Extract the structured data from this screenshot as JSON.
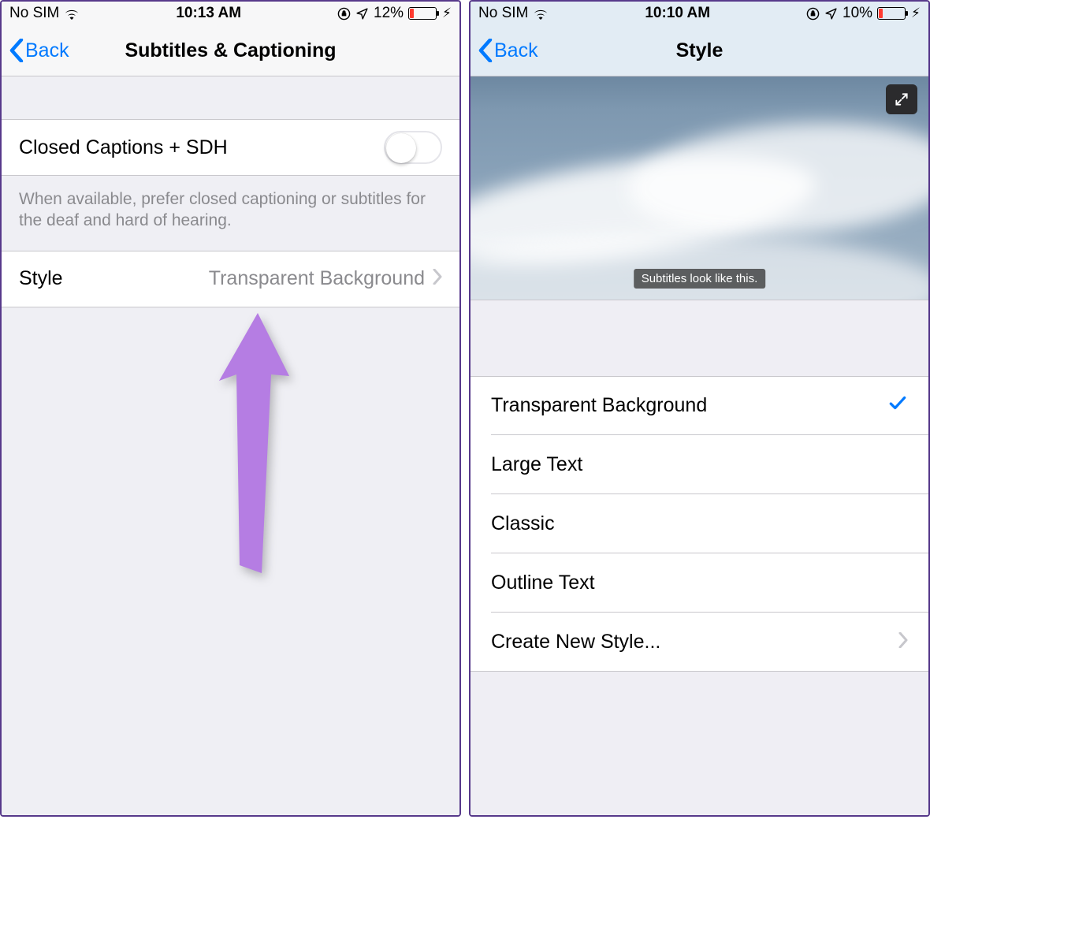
{
  "left": {
    "status": {
      "carrier": "No SIM",
      "time": "10:13 AM",
      "battery_pct": "12%"
    },
    "nav": {
      "back": "Back",
      "title": "Subtitles & Captioning"
    },
    "cc_row": {
      "label": "Closed Captions + SDH"
    },
    "cc_footer": "When available, prefer closed captioning or subtitles for the deaf and hard of hearing.",
    "style_row": {
      "label": "Style",
      "value": "Transparent Background"
    }
  },
  "right": {
    "status": {
      "carrier": "No SIM",
      "time": "10:10 AM",
      "battery_pct": "10%"
    },
    "nav": {
      "back": "Back",
      "title": "Style"
    },
    "preview_subtitle": "Subtitles look like this.",
    "styles": {
      "0": "Transparent Background",
      "1": "Large Text",
      "2": "Classic",
      "3": "Outline Text"
    },
    "create_new": "Create New Style..."
  }
}
